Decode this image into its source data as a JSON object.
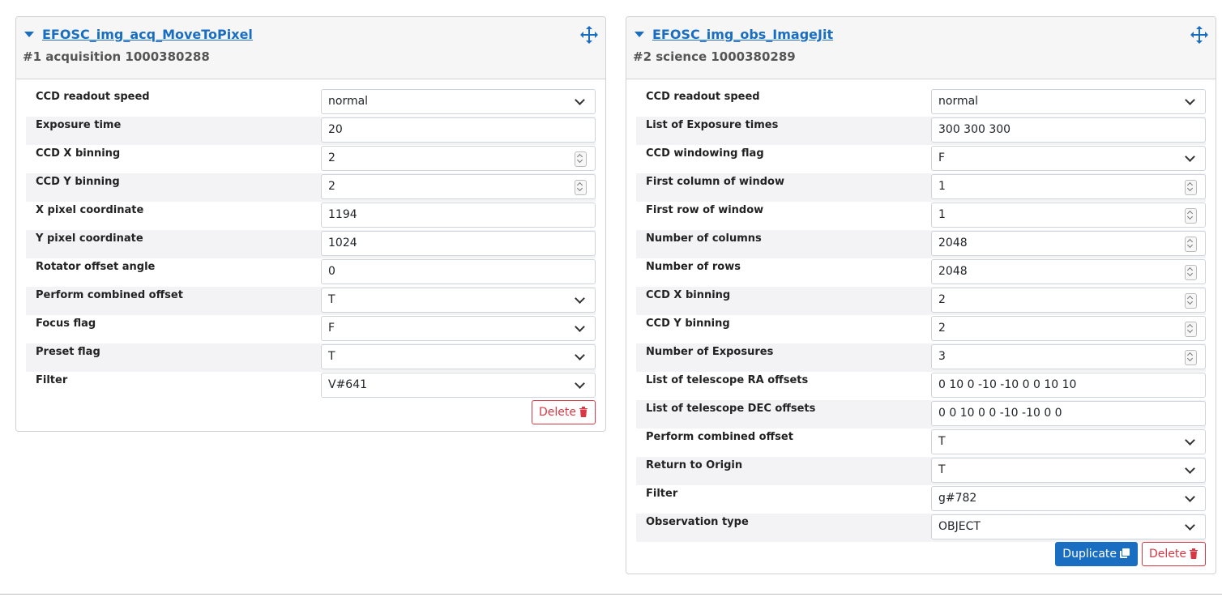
{
  "templates": [
    {
      "name": "EFOSC_img_acq_MoveToPixel",
      "index": "#1",
      "type_and_id": "acquisition 1000380288",
      "params": [
        {
          "label": "CCD readout speed",
          "value": "normal",
          "kind": "select"
        },
        {
          "label": "Exposure time",
          "value": "20",
          "kind": "text"
        },
        {
          "label": "CCD X binning",
          "value": "2",
          "kind": "number"
        },
        {
          "label": "CCD Y binning",
          "value": "2",
          "kind": "number"
        },
        {
          "label": "X pixel coordinate",
          "value": "1194",
          "kind": "text"
        },
        {
          "label": "Y pixel coordinate",
          "value": "1024",
          "kind": "text"
        },
        {
          "label": "Rotator offset angle",
          "value": "0",
          "kind": "text"
        },
        {
          "label": "Perform combined offset",
          "value": "T",
          "kind": "select"
        },
        {
          "label": "Focus flag",
          "value": "F",
          "kind": "select"
        },
        {
          "label": "Preset flag",
          "value": "T",
          "kind": "select"
        },
        {
          "label": "Filter",
          "value": "V#641",
          "kind": "select"
        }
      ],
      "buttons": {
        "delete": "Delete"
      }
    },
    {
      "name": "EFOSC_img_obs_ImageJit",
      "index": "#2",
      "type_and_id": "science 1000380289",
      "params": [
        {
          "label": "CCD readout speed",
          "value": "normal",
          "kind": "select"
        },
        {
          "label": "List of Exposure times",
          "value": "300 300 300",
          "kind": "text"
        },
        {
          "label": "CCD windowing flag",
          "value": "F",
          "kind": "select"
        },
        {
          "label": "First column of window",
          "value": "1",
          "kind": "number"
        },
        {
          "label": "First row of window",
          "value": "1",
          "kind": "number"
        },
        {
          "label": "Number of columns",
          "value": "2048",
          "kind": "number"
        },
        {
          "label": "Number of rows",
          "value": "2048",
          "kind": "number"
        },
        {
          "label": "CCD X binning",
          "value": "2",
          "kind": "number"
        },
        {
          "label": "CCD Y binning",
          "value": "2",
          "kind": "number"
        },
        {
          "label": "Number of Exposures",
          "value": "3",
          "kind": "number"
        },
        {
          "label": "List of telescope RA offsets",
          "value": "0 10 0 -10 -10 0 0 10 10",
          "kind": "text"
        },
        {
          "label": "List of telescope DEC offsets",
          "value": "0 0 10 0 0 -10 -10 0 0",
          "kind": "text"
        },
        {
          "label": "Perform combined offset",
          "value": "T",
          "kind": "select"
        },
        {
          "label": "Return to Origin",
          "value": "T",
          "kind": "select"
        },
        {
          "label": "Filter",
          "value": "g#782",
          "kind": "select"
        },
        {
          "label": "Observation type",
          "value": "OBJECT",
          "kind": "select"
        }
      ],
      "buttons": {
        "duplicate": "Duplicate",
        "delete": "Delete"
      }
    }
  ],
  "icons": {
    "collapse": "caret-down-icon",
    "move": "move-arrows-icon",
    "trash": "trash-icon",
    "duplicate": "copy-icon",
    "select": "chevron-down-icon",
    "spinner": "spinner-arrows-icon"
  },
  "colors": {
    "link": "#1a6ec1",
    "delete": "#d93744",
    "primary": "#1a6ec1",
    "row_shade": "#f3f3f5"
  }
}
